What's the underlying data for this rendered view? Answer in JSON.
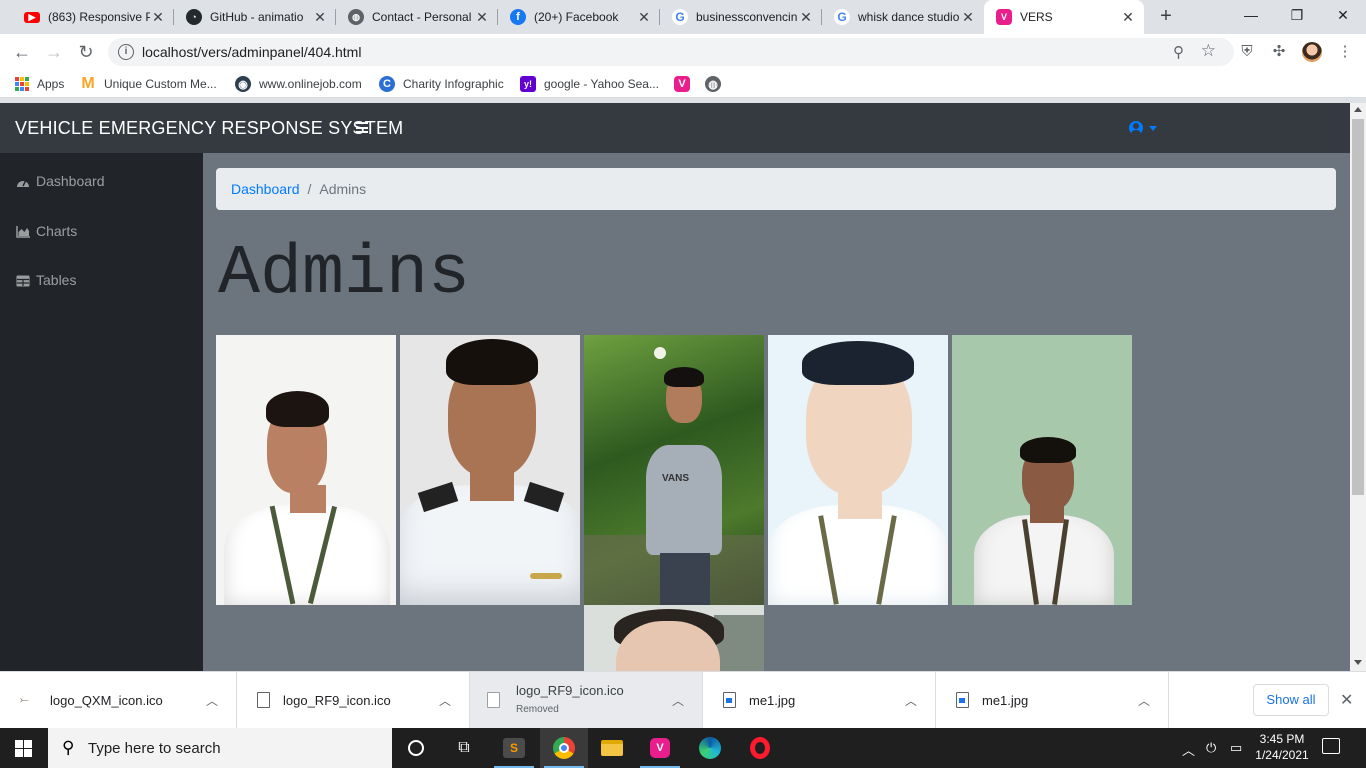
{
  "browser": {
    "tabs": [
      {
        "title": "(863) Responsive P",
        "icon": "youtube-icon",
        "color": "#ff0000",
        "glyph": "▶"
      },
      {
        "title": "GitHub - animatio",
        "icon": "github-icon",
        "color": "#24292e",
        "glyph": "●"
      },
      {
        "title": "Contact - Personal",
        "icon": "globe-icon",
        "color": "#5f6368",
        "glyph": "◍"
      },
      {
        "title": "(20+) Facebook",
        "icon": "facebook-icon",
        "color": "#1877f2",
        "glyph": "f"
      },
      {
        "title": "businessconvencin",
        "icon": "google-icon",
        "color": "#ffffff",
        "glyph": "G"
      },
      {
        "title": "whisk dance studio",
        "icon": "google-icon",
        "color": "#ffffff",
        "glyph": "G"
      },
      {
        "title": "VERS",
        "icon": "vers-icon",
        "color": "#e91e8c",
        "glyph": "V"
      }
    ],
    "active_tab": 6,
    "url": "localhost/vers/adminpanel/404.html",
    "bookmarks": [
      {
        "label": "Apps",
        "icon": "apps-grid-icon"
      },
      {
        "label": "Unique Custom Me...",
        "icon": "m-logo-icon",
        "color": "#f5a623",
        "glyph": "M"
      },
      {
        "label": "www.onlinejob.com",
        "icon": "onlinejob-icon",
        "color": "#2c3e50",
        "glyph": "◉"
      },
      {
        "label": "Charity Infographic",
        "icon": "canva-icon",
        "color": "#00c4cc",
        "glyph": "C"
      },
      {
        "label": "google - Yahoo Sea...",
        "icon": "yahoo-icon",
        "color": "#6001d2",
        "glyph": "y!"
      },
      {
        "label": "",
        "icon": "vers-bookmark-icon",
        "color": "#e91e8c",
        "glyph": "V"
      },
      {
        "label": "",
        "icon": "globe-bookmark-icon",
        "color": "#5f6368",
        "glyph": "◍"
      }
    ]
  },
  "app": {
    "brand": "VEHICLE EMERGENCY RESPONSE SYSTEM",
    "sidebar": [
      {
        "label": "Dashboard",
        "icon": "dashboard-icon"
      },
      {
        "label": "Charts",
        "icon": "area-chart-icon"
      },
      {
        "label": "Tables",
        "icon": "table-icon"
      }
    ],
    "breadcrumb": {
      "link": "Dashboard",
      "separator": "/",
      "current": "Admins"
    },
    "page_title": "Admins",
    "admin_photos": [
      {
        "name": "admin-photo-1",
        "bg": "#f4f4f2",
        "skin": "#b98063",
        "hair": "#1b1410",
        "shirt": "#ffffff"
      },
      {
        "name": "admin-photo-2",
        "bg": "#e6e6e6",
        "skin": "#a87454",
        "hair": "#15100c",
        "shirt": "#f2f5f8"
      },
      {
        "name": "admin-photo-3",
        "bg": "#3f6b2c",
        "skin": "#b07c5c",
        "hair": "#151010",
        "shirt": "#a6aeb8"
      },
      {
        "name": "admin-photo-4",
        "bg": "#e8f4fa",
        "skin": "#f0d5c0",
        "hair": "#1c2330",
        "shirt": "#ffffff"
      },
      {
        "name": "admin-photo-5",
        "bg": "#a8c8ac",
        "skin": "#8a5a42",
        "hair": "#14100c",
        "shirt": "#f4f4f4"
      },
      {
        "name": "admin-photo-6",
        "bg": "#dadfdc",
        "skin": "#e6c6b0",
        "hair": "#2a2420",
        "shirt": "#ffffff"
      }
    ],
    "colors": {
      "navbar": "#343a40",
      "sidebar": "#212529",
      "content": "#6c757d",
      "link": "#007bff"
    }
  },
  "downloads": [
    {
      "file": "logo_QXM_icon.ico",
      "status": "",
      "icon": "ico-file-icon"
    },
    {
      "file": "logo_RF9_icon.ico",
      "status": "",
      "icon": "file-icon"
    },
    {
      "file": "logo_RF9_icon.ico",
      "status": "Removed",
      "icon": "file-icon"
    },
    {
      "file": "me1.jpg",
      "status": "",
      "icon": "image-file-icon"
    },
    {
      "file": "me1.jpg",
      "status": "",
      "icon": "image-file-icon"
    }
  ],
  "downloads_show_all": "Show all",
  "taskbar": {
    "search_placeholder": "Type here to search",
    "time": "3:45 PM",
    "date": "1/24/2021"
  }
}
